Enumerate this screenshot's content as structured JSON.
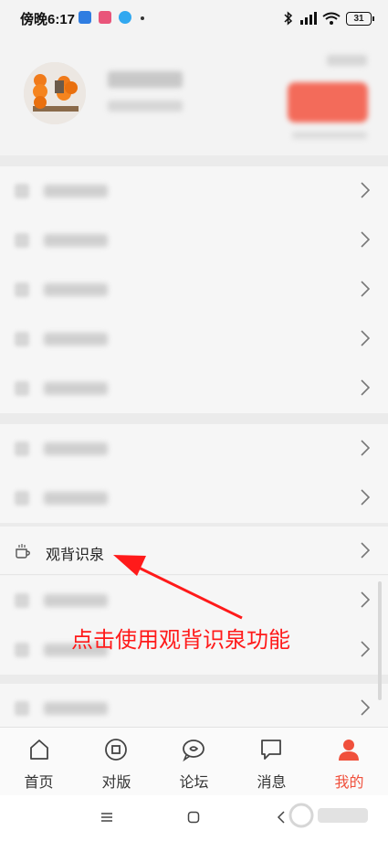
{
  "status_bar": {
    "time": "傍晚6:17",
    "battery": "31"
  },
  "menu": {
    "highlighted_item": "观背识泉"
  },
  "annotation": {
    "text": "点击使用观背识泉功能",
    "color": "#ff1a1a"
  },
  "tab_bar": {
    "tabs": [
      {
        "label": "首页",
        "icon": "home-icon"
      },
      {
        "label": "对版",
        "icon": "coin-icon"
      },
      {
        "label": "论坛",
        "icon": "forum-icon"
      },
      {
        "label": "消息",
        "icon": "message-icon"
      },
      {
        "label": "我的",
        "icon": "user-icon",
        "active": true
      }
    ]
  },
  "colors": {
    "accent": "#f0503c",
    "annotation": "#ff1a1a"
  }
}
